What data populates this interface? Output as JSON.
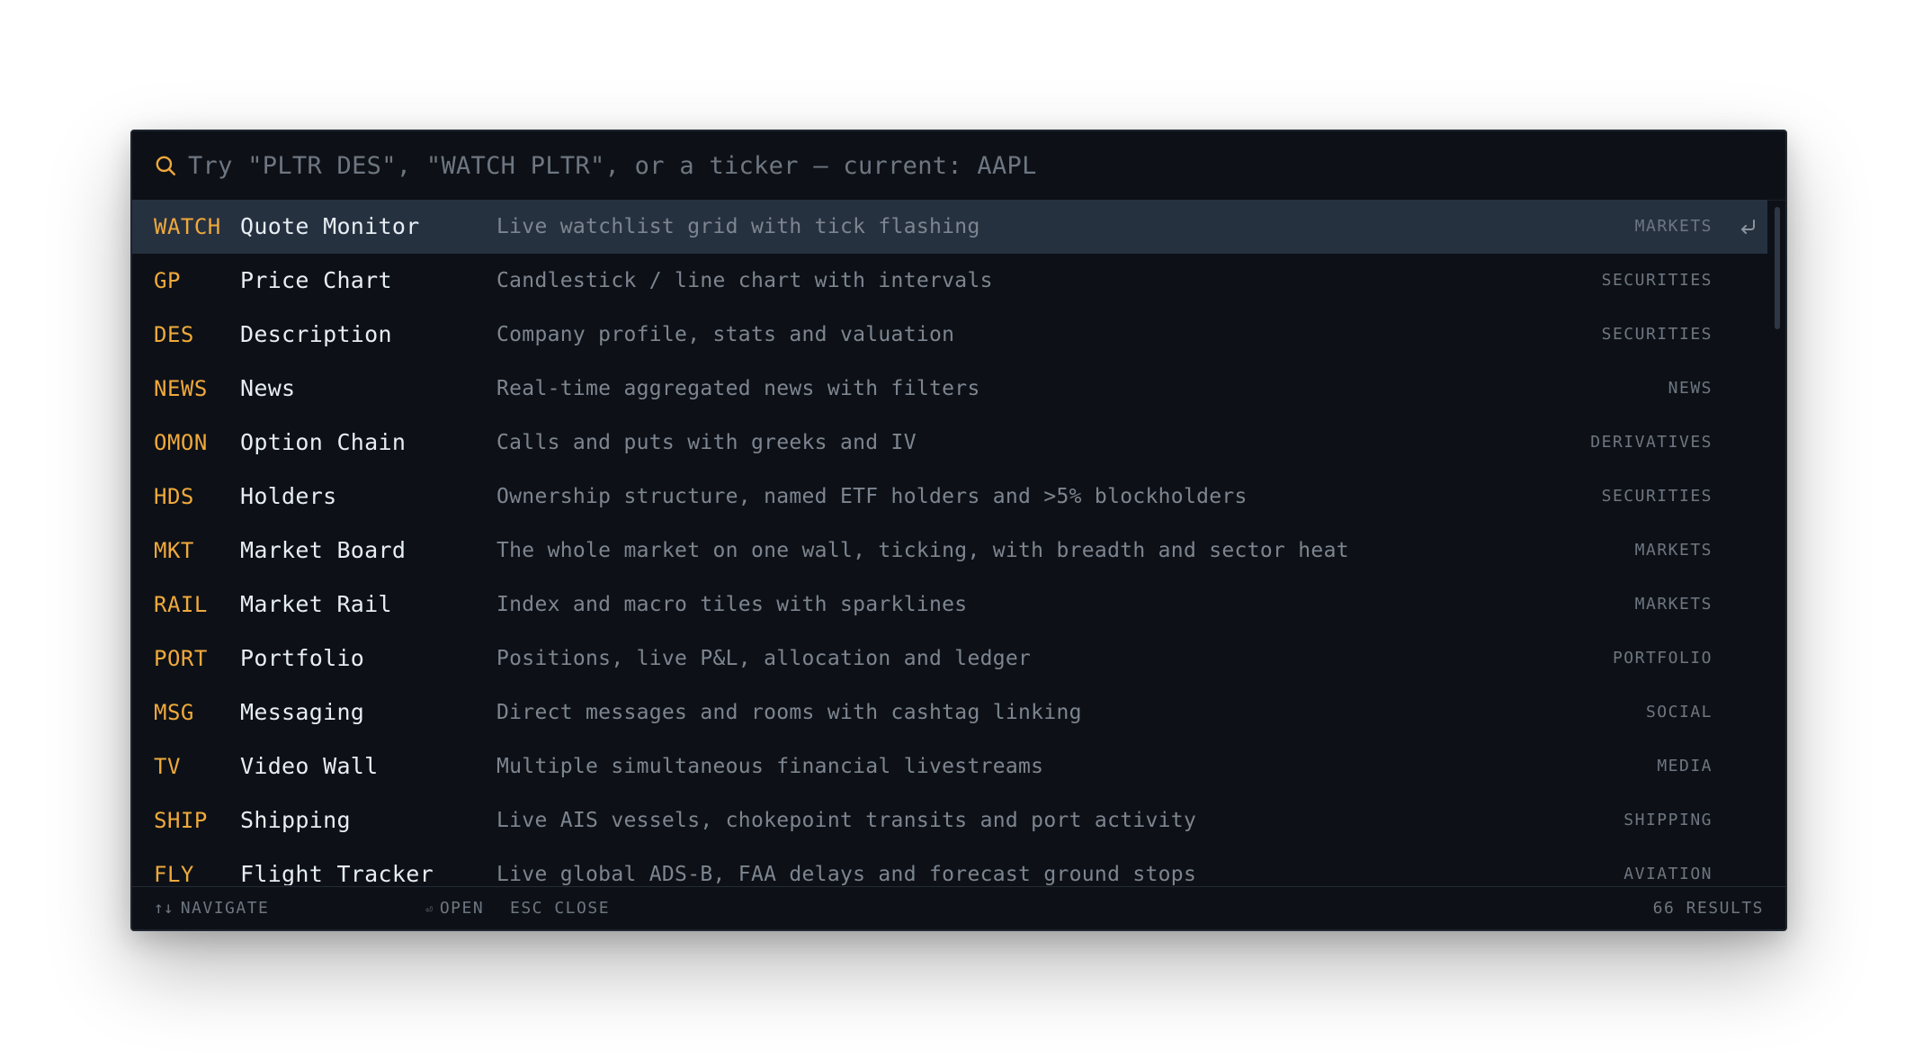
{
  "search": {
    "placeholder": "Try \"PLTR DES\", \"WATCH PLTR\", or a ticker — current: AAPL",
    "value": "",
    "icon": "search-icon"
  },
  "colors": {
    "accent": "#f0a93c",
    "background": "#0d1117",
    "selected_row": "#263140"
  },
  "results": [
    {
      "code": "WATCH",
      "name": "Quote Monitor",
      "desc": "Live watchlist grid with tick flashing",
      "category": "MARKETS",
      "selected": true
    },
    {
      "code": "GP",
      "name": "Price Chart",
      "desc": "Candlestick / line chart with intervals",
      "category": "SECURITIES"
    },
    {
      "code": "DES",
      "name": "Description",
      "desc": "Company profile, stats and valuation",
      "category": "SECURITIES"
    },
    {
      "code": "NEWS",
      "name": "News",
      "desc": "Real-time aggregated news with filters",
      "category": "NEWS"
    },
    {
      "code": "OMON",
      "name": "Option Chain",
      "desc": "Calls and puts with greeks and IV",
      "category": "DERIVATIVES"
    },
    {
      "code": "HDS",
      "name": "Holders",
      "desc": "Ownership structure, named ETF holders and >5% blockholders",
      "category": "SECURITIES"
    },
    {
      "code": "MKT",
      "name": "Market Board",
      "desc": "The whole market on one wall, ticking, with breadth and sector heat",
      "category": "MARKETS"
    },
    {
      "code": "RAIL",
      "name": "Market Rail",
      "desc": "Index and macro tiles with sparklines",
      "category": "MARKETS"
    },
    {
      "code": "PORT",
      "name": "Portfolio",
      "desc": "Positions, live P&L, allocation and ledger",
      "category": "PORTFOLIO"
    },
    {
      "code": "MSG",
      "name": "Messaging",
      "desc": "Direct messages and rooms with cashtag linking",
      "category": "SOCIAL"
    },
    {
      "code": "TV",
      "name": "Video Wall",
      "desc": "Multiple simultaneous financial livestreams",
      "category": "MEDIA"
    },
    {
      "code": "SHIP",
      "name": "Shipping",
      "desc": "Live AIS vessels, chokepoint transits and port activity",
      "category": "SHIPPING"
    },
    {
      "code": "FLY",
      "name": "Flight Tracker",
      "desc": "Live global ADS-B, FAA delays and forecast ground stops",
      "category": "AVIATION"
    }
  ],
  "footer": {
    "navigate_glyph": "↑↓",
    "navigate_label": "NAVIGATE",
    "open_glyph": "⏎",
    "open_label": "OPEN",
    "close_label": "ESC CLOSE",
    "count_label": "66 RESULTS"
  }
}
